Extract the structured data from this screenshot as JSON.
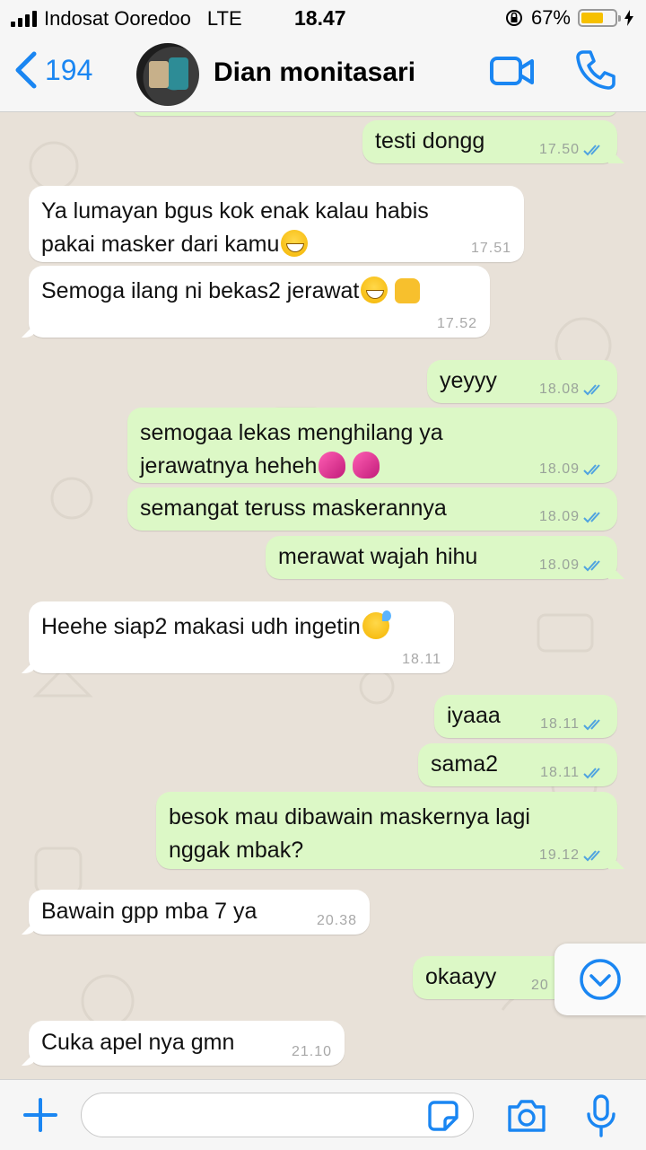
{
  "status_bar": {
    "carrier": "Indosat Ooredoo",
    "network": "LTE",
    "time": "18.47",
    "battery_percent": "67%",
    "battery_level": 0.67
  },
  "header": {
    "back_count": "194",
    "contact_name": "Dian monitasari"
  },
  "messages": [
    {
      "dir": "out",
      "text": "testi dongg",
      "time": "17.50"
    },
    {
      "dir": "in",
      "text": "Ya lumayan bgus kok enak kalau habis",
      "text2": "pakai masker dari kamu",
      "time": "17.51"
    },
    {
      "dir": "in",
      "text": "Semoga ilang ni bekas2 jerawat",
      "time": "17.52"
    },
    {
      "dir": "out",
      "text": "yeyyy",
      "time": "18.08"
    },
    {
      "dir": "out",
      "text": "semogaa lekas menghilang ya",
      "text2": "jerawatnya heheh",
      "time": "18.09"
    },
    {
      "dir": "out",
      "text": "semangat teruss maskerannya",
      "time": "18.09"
    },
    {
      "dir": "out",
      "text": "merawat wajah hihu",
      "time": "18.09"
    },
    {
      "dir": "in",
      "text": "Heehe siap2 makasi udh ingetin",
      "time": "18.11"
    },
    {
      "dir": "out",
      "text": "iyaaa",
      "time": "18.11"
    },
    {
      "dir": "out",
      "text": "sama2",
      "time": "18.11"
    },
    {
      "dir": "out",
      "text": "besok mau dibawain maskernya lagi",
      "text2": "nggak mbak?",
      "time": "19.12"
    },
    {
      "dir": "in",
      "text": "Bawain gpp mba 7 ya",
      "time": "20.38"
    },
    {
      "dir": "out",
      "text": "okaayy",
      "time": "20"
    },
    {
      "dir": "in",
      "text": "Cuka apel nya gmn",
      "time": "21.10"
    }
  ],
  "input": {
    "placeholder": ""
  },
  "colors": {
    "accent": "#1a86f2",
    "outgoing_bubble": "#dcf8c6",
    "incoming_bubble": "#ffffff",
    "read_tick": "#4fa3e0"
  },
  "icons": [
    "back-chevron-icon",
    "video-call-icon",
    "phone-call-icon",
    "scroll-down-icon",
    "add-icon",
    "sticker-icon",
    "camera-icon",
    "microphone-icon"
  ]
}
